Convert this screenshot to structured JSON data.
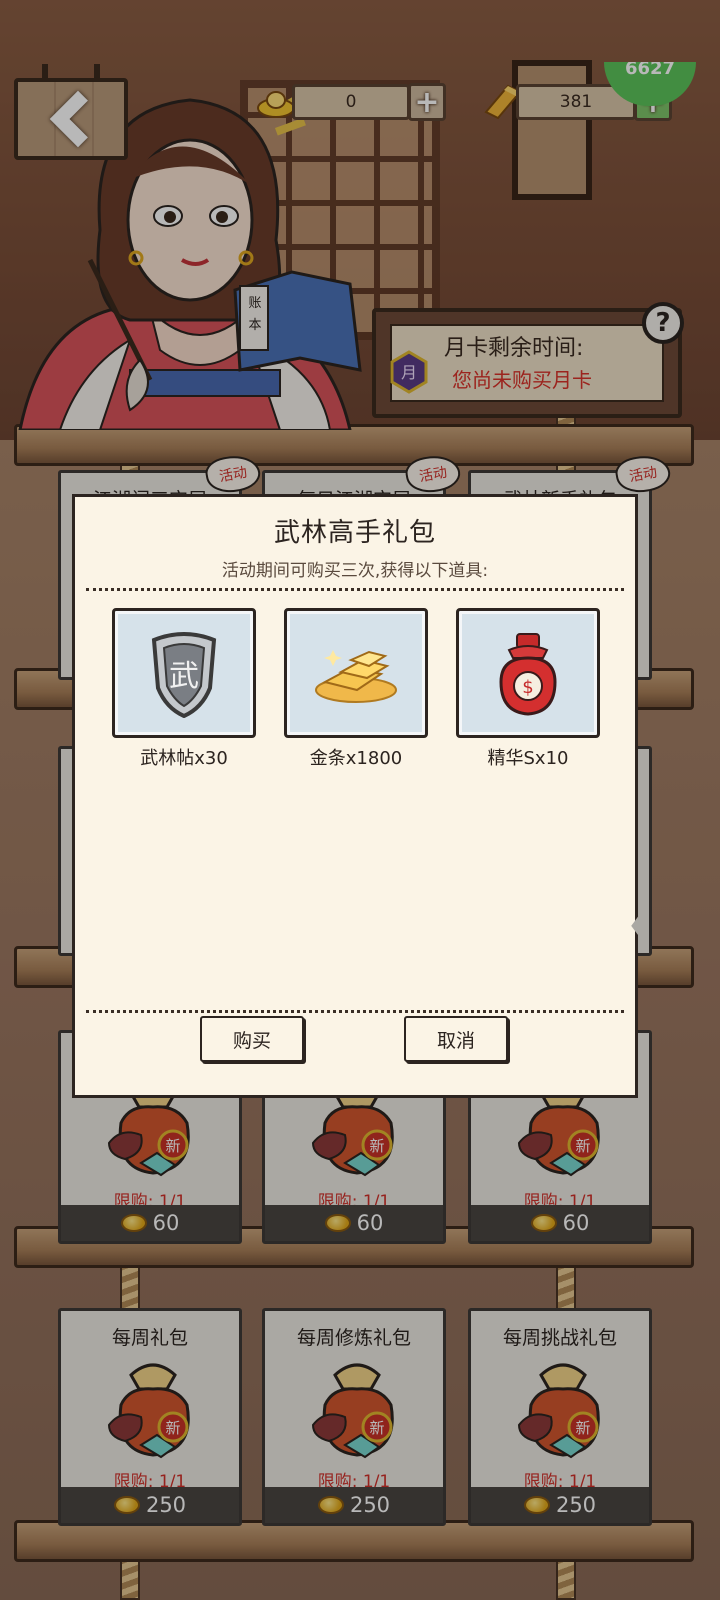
{
  "hud": {
    "gold_value": "0",
    "bar_value": "381",
    "plus": "+",
    "corner_badge": "6627"
  },
  "month_card": {
    "title": "月卡剩余时间:",
    "status": "您尚未购买月卡",
    "help": "?"
  },
  "lady_book": {
    "line1": "账",
    "line2": "本"
  },
  "shop": {
    "top_row": [
      {
        "title": "江湖闯三宝屋",
        "tag": "活动"
      },
      {
        "title": "每日江湖宝屋",
        "tag": "活动"
      },
      {
        "title": "武林新手礼包",
        "tag": "活动"
      }
    ],
    "third_row": [
      {
        "limit": "限购: 1/1",
        "price": "60"
      },
      {
        "limit": "限购: 1/1",
        "price": "60"
      },
      {
        "limit": "限购: 1/1",
        "price": "60"
      }
    ],
    "bottom_row": [
      {
        "title": "每周礼包",
        "limit": "限购: 1/1",
        "price": "250"
      },
      {
        "title": "每周修炼礼包",
        "limit": "限购: 1/1",
        "price": "250"
      },
      {
        "title": "每周挑战礼包",
        "limit": "限购: 1/1",
        "price": "250"
      }
    ],
    "bag_badge": "新"
  },
  "modal": {
    "title": "武林高手礼包",
    "description": "活动期间可购买三次,获得以下道具:",
    "items": [
      {
        "label": "武林帖x30",
        "icon": "wulin-token-icon",
        "glyph": "武"
      },
      {
        "label": "金条x1800",
        "icon": "gold-bars-icon"
      },
      {
        "label": "精华Sx10",
        "icon": "essence-pouch-icon",
        "glyph": "$"
      }
    ],
    "buy_label": "购买",
    "cancel_label": "取消"
  },
  "colors": {
    "limit_red": "#d0302a",
    "price_bar": "#4a4642",
    "modal_paper": "#fbf4e6"
  }
}
